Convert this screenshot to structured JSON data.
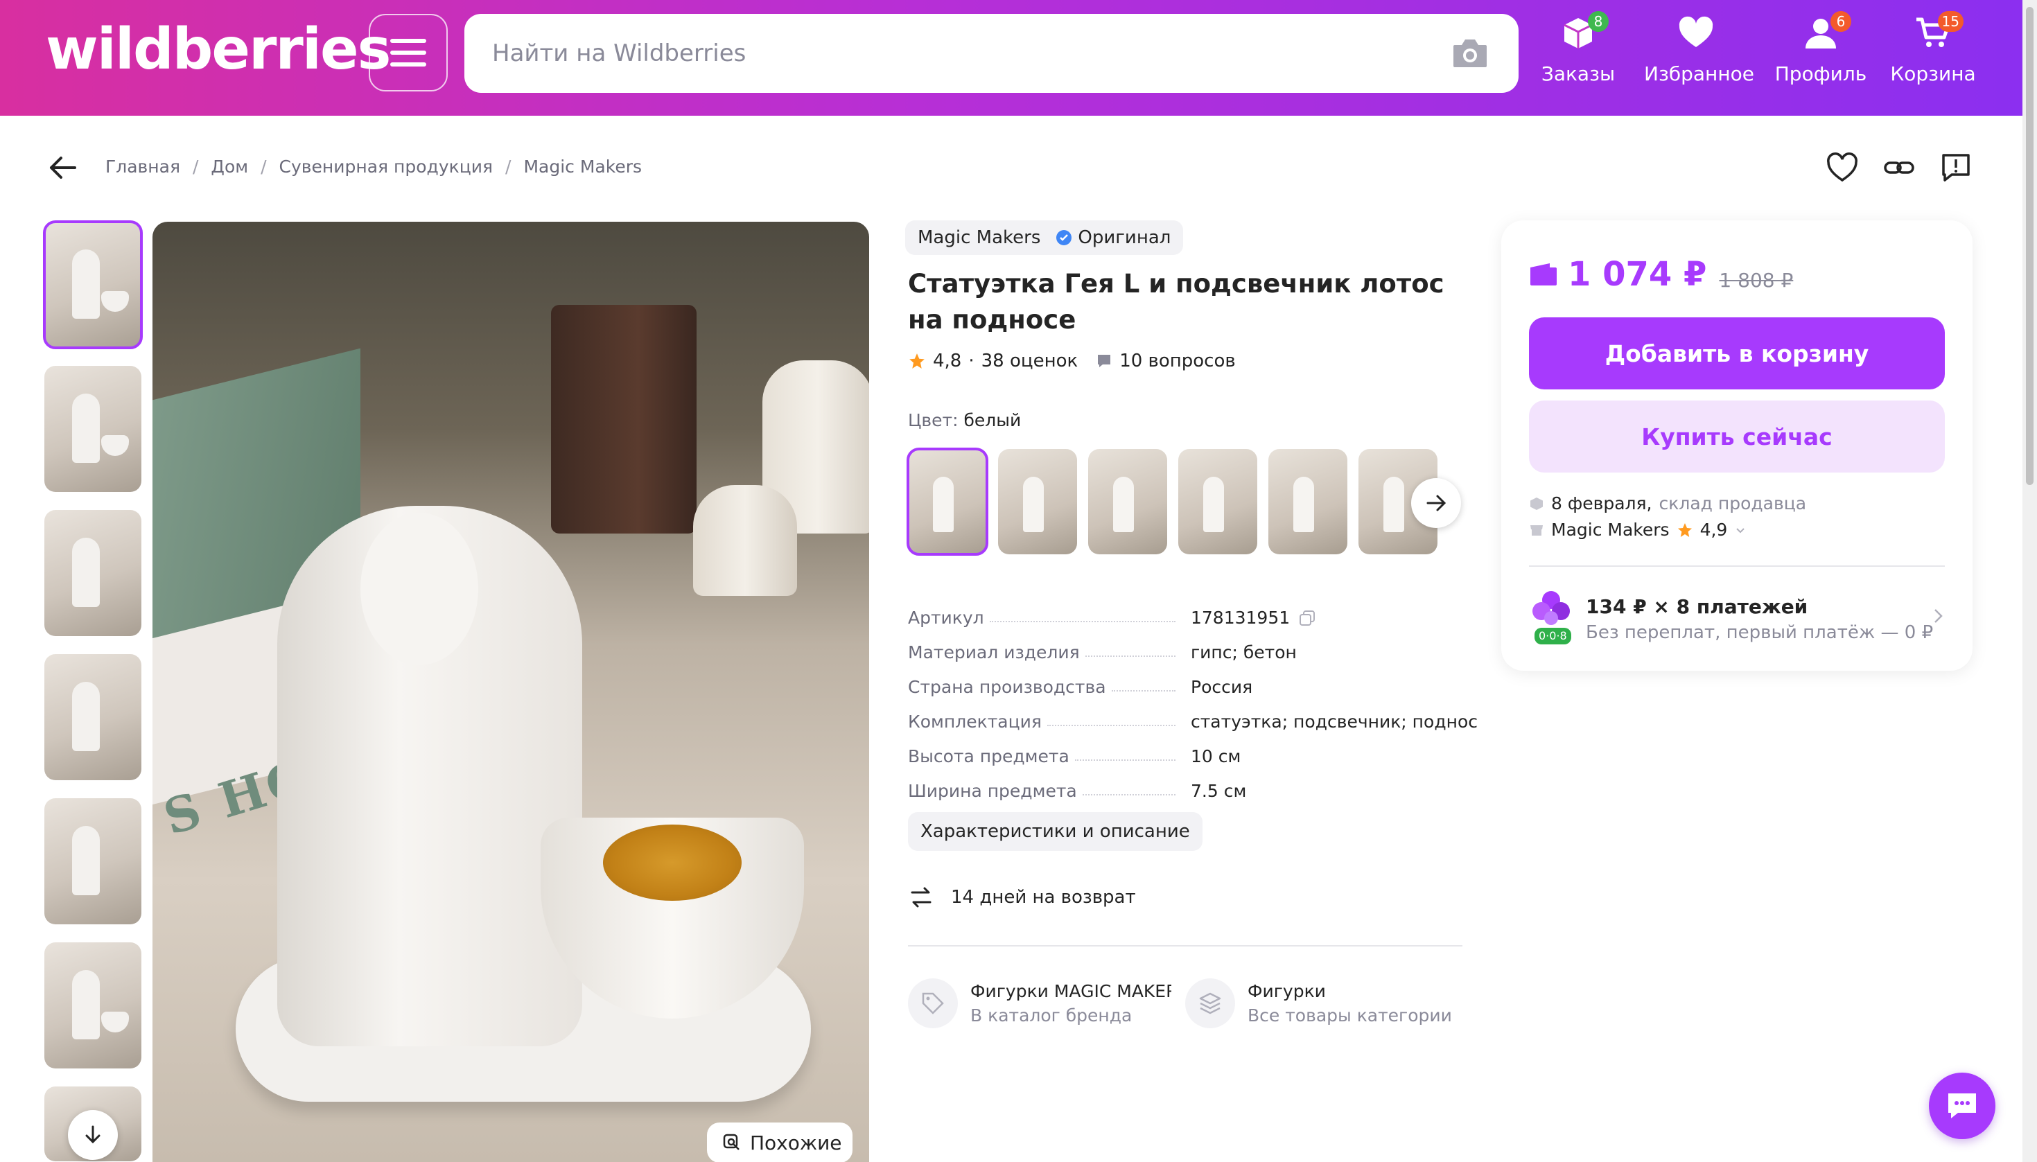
{
  "header": {
    "logo": "wildberries",
    "search_placeholder": "Найти на Wildberries",
    "nav": [
      {
        "label": "Заказы",
        "badge": "8",
        "icon": "box-icon"
      },
      {
        "label": "Избранное",
        "badge": "",
        "icon": "heart-icon"
      },
      {
        "label": "Профиль",
        "badge": "6",
        "icon": "user-icon"
      },
      {
        "label": "Корзина",
        "badge": "15",
        "icon": "cart-icon"
      }
    ]
  },
  "breadcrumbs": [
    "Главная",
    "Дом",
    "Сувенирная продукция",
    "Magic Makers"
  ],
  "gallery": {
    "similar_label": "Похожие"
  },
  "product": {
    "brand": "Magic Makers",
    "original_label": "Оригинал",
    "title": "Статуэтка Гея L и подсвечник лотос на подносе",
    "rating": "4,8",
    "reviews": "38 оценок",
    "questions": "10 вопросов",
    "color_label": "Цвет:",
    "color_value": "белый",
    "specs": [
      {
        "key": "Артикул",
        "value": "178131951"
      },
      {
        "key": "Материал изделия",
        "value": "гипс; бетон"
      },
      {
        "key": "Страна производства",
        "value": "Россия"
      },
      {
        "key": "Комплектация",
        "value": "статуэтка; подсвечник; поднос"
      },
      {
        "key": "Высота предмета",
        "value": "10 см"
      },
      {
        "key": "Ширина предмета",
        "value": "7.5 см"
      }
    ],
    "description_button": "Характеристики и описание",
    "return_text": "14 дней на возврат",
    "links": [
      {
        "title": "Фигурки MAGIC MAKERS",
        "subtitle": "В каталог бренда"
      },
      {
        "title": "Фигурки",
        "subtitle": "Все товары категории"
      }
    ]
  },
  "buy": {
    "price": "1 074 ₽",
    "old_price": "1 808 ₽",
    "add_to_cart": "Добавить в корзину",
    "buy_now": "Купить сейчас",
    "delivery_date": "8 февраля,",
    "delivery_from": "склад продавца",
    "seller": "Magic Makers",
    "seller_rating": "4,9",
    "installment_title": "134 ₽ × 8 платежей",
    "installment_subtitle": "Без переплат, первый платёж — 0 ₽",
    "installment_chip": "0·0·8"
  },
  "colors": {
    "accent": "#a73afd",
    "header_start": "#d82fa0",
    "header_end": "#8b2ff0"
  }
}
